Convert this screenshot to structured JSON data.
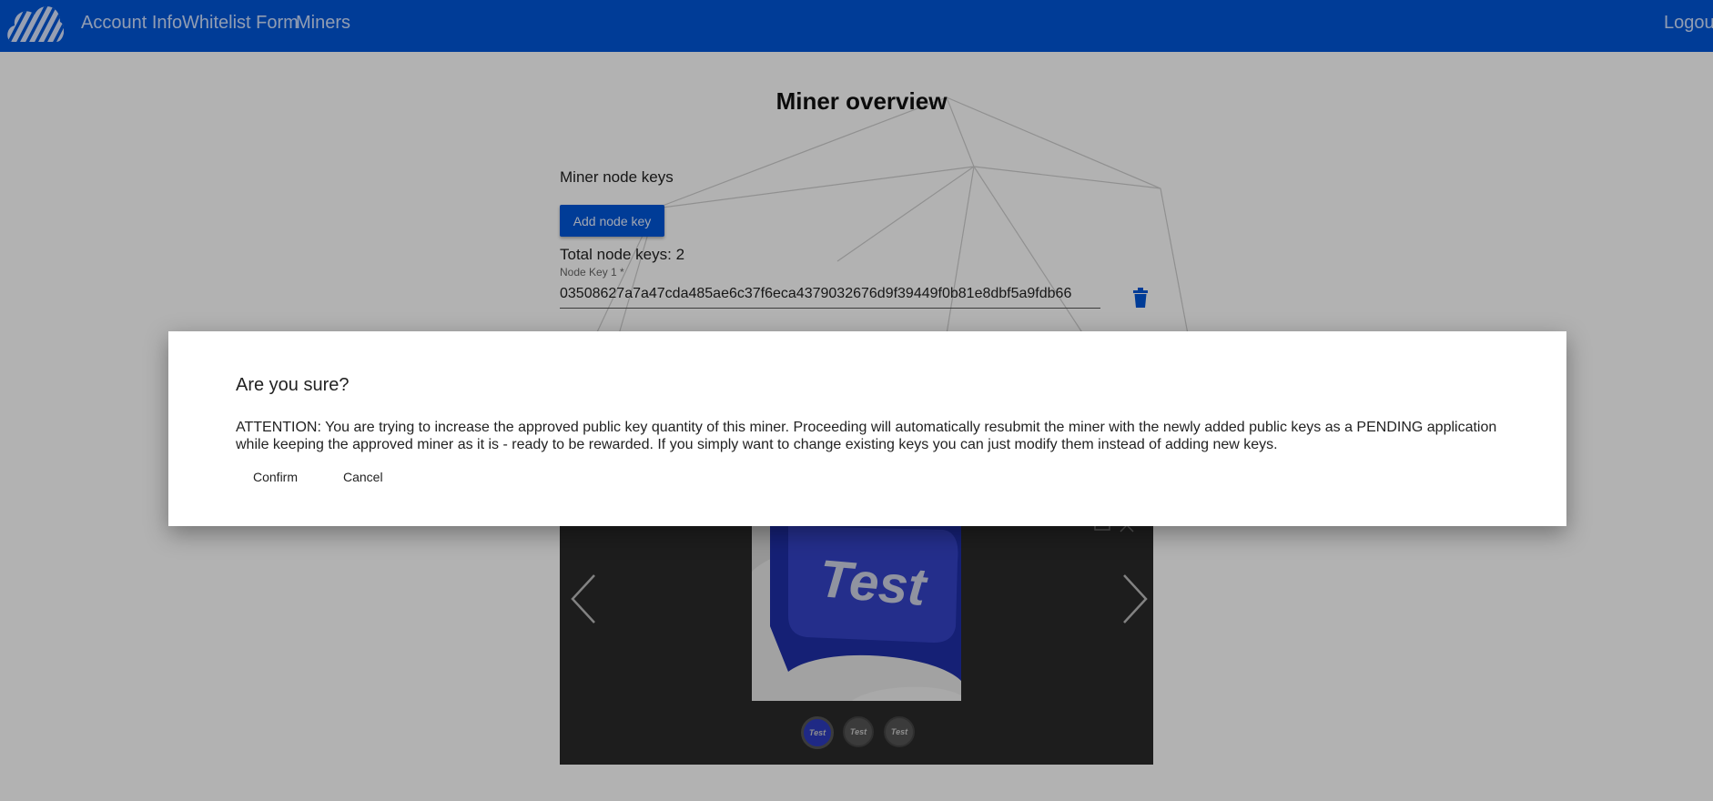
{
  "nav": {
    "links": [
      "Account Info",
      "Whitelist Form",
      "Miners"
    ],
    "logout": "Logout",
    "background": "#0057d9"
  },
  "page": {
    "title": "Miner overview",
    "section_label": "Miner node keys",
    "add_button": "Add node key",
    "total_label": "Total node keys: 2",
    "key_field_label": "Node Key 1 *",
    "key_value": "03508627a7a47cda485ae6c37f6eca4379032676d9f39449f0b81e8dbf5a9fdb66"
  },
  "gallery": {
    "image_text": "Test",
    "thumbnails": [
      "Test",
      "Test",
      "Test"
    ],
    "selected_thumbnail": 1
  },
  "dialog": {
    "title": "Are you sure?",
    "body": "ATTENTION: You are trying to increase the approved public key quantity of this miner. Proceeding will automatically resubmit the miner with the newly added public keys as a PENDING application while keeping the approved miner as it is - ready to be rewarded. If you simply want to change existing keys you can just modify them instead of adding new keys.",
    "confirm": "Confirm",
    "cancel": "Cancel"
  }
}
